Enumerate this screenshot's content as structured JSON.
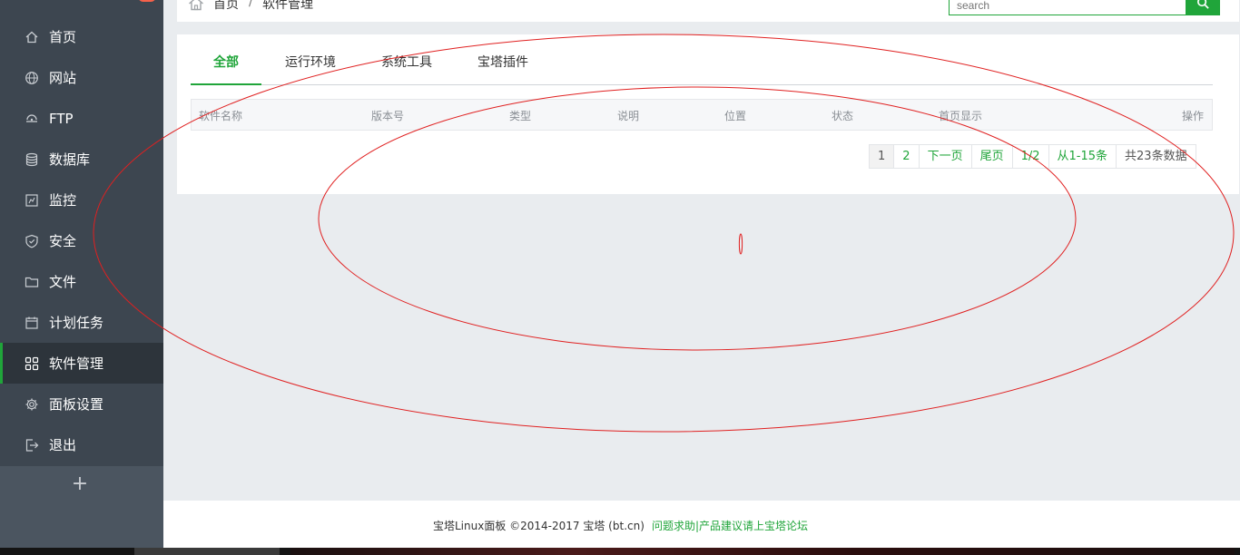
{
  "sidebar": {
    "items": [
      {
        "label": "首页",
        "icon": "home-icon"
      },
      {
        "label": "网站",
        "icon": "globe-icon"
      },
      {
        "label": "FTP",
        "icon": "ftp-icon"
      },
      {
        "label": "数据库",
        "icon": "database-icon"
      },
      {
        "label": "监控",
        "icon": "monitor-icon"
      },
      {
        "label": "安全",
        "icon": "shield-icon"
      },
      {
        "label": "文件",
        "icon": "folder-icon"
      },
      {
        "label": "计划任务",
        "icon": "calendar-icon"
      },
      {
        "label": "软件管理",
        "icon": "grid-icon",
        "active": true
      },
      {
        "label": "面板设置",
        "icon": "gear-icon"
      },
      {
        "label": "退出",
        "icon": "logout-icon"
      }
    ],
    "add_label": "+"
  },
  "breadcrumb": {
    "home": "首页",
    "separator": "/",
    "current": "软件管理"
  },
  "search": {
    "placeholder": "search",
    "value": ""
  },
  "tabs": [
    {
      "label": "全部",
      "active": true
    },
    {
      "label": "运行环境"
    },
    {
      "label": "系统工具"
    },
    {
      "label": "宝塔插件"
    }
  ],
  "table": {
    "columns": [
      "软件名称",
      "版本号",
      "类型",
      "说明",
      "位置",
      "状态",
      "首页显示",
      "操作"
    ]
  },
  "pagination": {
    "current": "1",
    "next_page_num": "2",
    "next": "下一页",
    "last": "尾页",
    "page_ratio": "1/2",
    "range": "从1-15条",
    "total": "共23条数据"
  },
  "footer": {
    "copyright": "宝塔Linux面板 ©2014-2017 宝塔 (bt.cn)",
    "link": "问题求助|产品建议请上宝塔论坛"
  },
  "colors": {
    "accent": "#20a53a",
    "sidebar_bg": "#3d4650",
    "annotation": "#e02020"
  }
}
